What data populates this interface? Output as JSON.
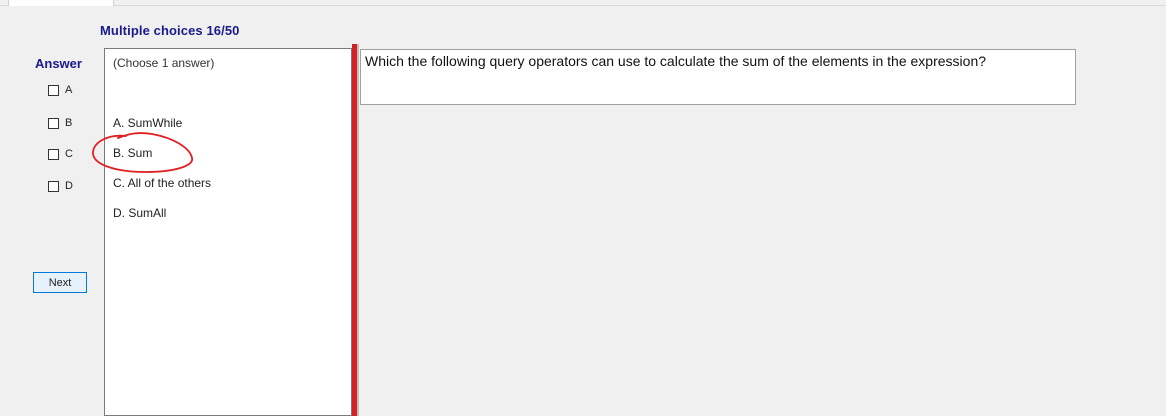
{
  "header": {
    "title": "Multiple choices 16/50"
  },
  "answer_sidebar": {
    "label": "Answer",
    "options": [
      "A",
      "B",
      "C",
      "D"
    ],
    "next_label": "Next"
  },
  "choices_panel": {
    "hint": "(Choose 1 answer)",
    "choices": [
      "A. SumWhile",
      "B. Sum",
      "C. All of the others",
      "D. SumAll"
    ]
  },
  "question": {
    "text": "Which the following query operators can use to calculate the sum of the elements in the expression?"
  },
  "colors": {
    "title": "#1a1a8c",
    "splitter": "#d42222",
    "annotation": "#e02020"
  }
}
